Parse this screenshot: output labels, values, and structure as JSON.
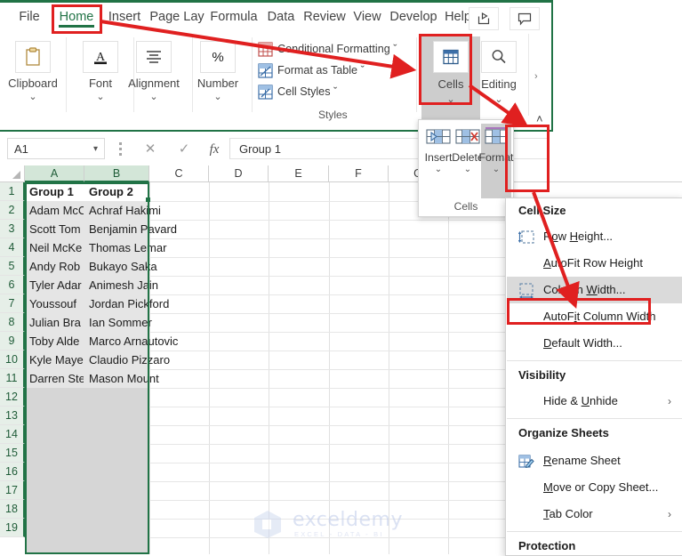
{
  "colors": {
    "excel_green": "#217346",
    "annotation_red": "#e02020",
    "selection_fill": "#d6d6d6",
    "menu_highlight": "#dadada",
    "header_selected": "#d3e6d8"
  },
  "ribbon": {
    "tabs": [
      {
        "label": "File",
        "active": false
      },
      {
        "label": "Home",
        "active": true
      },
      {
        "label": "Insert",
        "active": false
      },
      {
        "label": "Page Lay",
        "active": false
      },
      {
        "label": "Formula",
        "active": false
      },
      {
        "label": "Data",
        "active": false
      },
      {
        "label": "Review",
        "active": false
      },
      {
        "label": "View",
        "active": false
      },
      {
        "label": "Develop",
        "active": false
      },
      {
        "label": "Help",
        "active": false
      }
    ],
    "quick_access": [
      {
        "name": "share-icon"
      },
      {
        "name": "comment-icon"
      }
    ],
    "groups": [
      {
        "label": "Clipboard",
        "icon": "clipboard-icon",
        "caret": "⌄"
      },
      {
        "label": "Font",
        "icon": "font-a-icon",
        "caret": "⌄"
      },
      {
        "label": "Alignment",
        "icon": "alignment-icon",
        "caret": "⌄"
      },
      {
        "label": "Number",
        "icon": "percent-icon",
        "caret": "⌄"
      },
      {
        "label": "Cells",
        "icon": "cells-grid-icon",
        "caret": "⌄"
      },
      {
        "label": "Editing",
        "icon": "magnifier-icon",
        "caret": "⌄"
      }
    ],
    "styles": {
      "group_label": "Styles",
      "items": [
        {
          "label": "Conditional Formatting",
          "icon": "conditional-formatting-icon",
          "caret": "ˇ"
        },
        {
          "label": "Format as Table",
          "icon": "format-as-table-icon",
          "caret": "ˇ"
        },
        {
          "label": "Cell Styles",
          "icon": "cell-styles-icon",
          "caret": "ˇ"
        }
      ]
    },
    "scroll_arrow": "›",
    "collapse_caret": "˄"
  },
  "formula_bar": {
    "name_box_value": "A1",
    "name_box_caret": "▾",
    "cancel_icon": "✕",
    "enter_icon": "✓",
    "function_icon": "fx",
    "formula_value": "Group 1"
  },
  "grid": {
    "column_headers": [
      "A",
      "B",
      "C",
      "D",
      "E",
      "F",
      "G"
    ],
    "selected_columns": [
      "A",
      "B"
    ],
    "row_headers": [
      "1",
      "2",
      "3",
      "4",
      "5",
      "6",
      "7",
      "8",
      "9",
      "10",
      "11",
      "12",
      "13",
      "14",
      "15",
      "16",
      "17",
      "18",
      "19"
    ],
    "selected_rows_all": true,
    "rows": [
      {
        "num": "1",
        "a": "Group 1",
        "b": "Group 2",
        "header": true
      },
      {
        "num": "2",
        "a": "Adam McC",
        "b": "Achraf Hakimi"
      },
      {
        "num": "3",
        "a": "Scott Tom",
        "b": "Benjamin Pavard"
      },
      {
        "num": "4",
        "a": "Neil McKe",
        "b": "Thomas Lemar"
      },
      {
        "num": "5",
        "a": "Andy Rob",
        "b": "Bukayo Saka"
      },
      {
        "num": "6",
        "a": "Tyler Adar",
        "b": "Animesh Jain"
      },
      {
        "num": "7",
        "a": "Youssouf ",
        "b": "Jordan Pickford"
      },
      {
        "num": "8",
        "a": "Julian Bra",
        "b": "Ian Sommer"
      },
      {
        "num": "9",
        "a": "Toby Alde",
        "b": "Marco Arnautovic"
      },
      {
        "num": "10",
        "a": "Kyle Maye",
        "b": "Claudio Pizzaro"
      },
      {
        "num": "11",
        "a": "Darren Ste",
        "b": "Mason Mount"
      },
      {
        "num": "12",
        "a": "",
        "b": ""
      },
      {
        "num": "13",
        "a": "",
        "b": ""
      },
      {
        "num": "14",
        "a": "",
        "b": ""
      },
      {
        "num": "15",
        "a": "",
        "b": ""
      },
      {
        "num": "16",
        "a": "",
        "b": ""
      },
      {
        "num": "17",
        "a": "",
        "b": ""
      },
      {
        "num": "18",
        "a": "",
        "b": ""
      },
      {
        "num": "19",
        "a": "",
        "b": ""
      }
    ]
  },
  "cells_panel": {
    "group_label": "Cells",
    "buttons": [
      {
        "label": "Insert",
        "icon": "insert-cells-icon",
        "caret": "⌄",
        "highlighted": false
      },
      {
        "label": "Delete",
        "icon": "delete-cells-icon",
        "caret": "⌄",
        "highlighted": false
      },
      {
        "label": "Format",
        "icon": "format-cells-icon",
        "caret": "⌄",
        "highlighted": true
      }
    ]
  },
  "format_menu": {
    "sections": [
      {
        "header": "Cell Size",
        "items": [
          {
            "label": "Row Height...",
            "icon": "row-height-icon",
            "accel": "H",
            "highlighted": false,
            "submenu": false
          },
          {
            "label": "AutoFit Row Height",
            "icon": "",
            "accel": "A",
            "highlighted": false,
            "submenu": false
          },
          {
            "label": "Column Width...",
            "icon": "column-width-icon",
            "accel": "W",
            "highlighted": true,
            "submenu": false
          },
          {
            "label": "AutoFit Column Width",
            "icon": "",
            "accel": "i",
            "highlighted": false,
            "submenu": false
          },
          {
            "label": "Default Width...",
            "icon": "",
            "accel": "D",
            "highlighted": false,
            "submenu": false
          }
        ]
      },
      {
        "header": "Visibility",
        "items": [
          {
            "label": "Hide & Unhide",
            "icon": "",
            "accel": "U",
            "highlighted": false,
            "submenu": true
          }
        ]
      },
      {
        "header": "Organize Sheets",
        "items": [
          {
            "label": "Rename Sheet",
            "icon": "rename-sheet-icon",
            "accel": "R",
            "highlighted": false,
            "submenu": false
          },
          {
            "label": "Move or Copy Sheet...",
            "icon": "",
            "accel": "M",
            "highlighted": false,
            "submenu": false
          },
          {
            "label": "Tab Color",
            "icon": "",
            "accel": "T",
            "highlighted": false,
            "submenu": true
          }
        ]
      },
      {
        "header": "Protection",
        "items": []
      }
    ],
    "submenu_arrow": "›"
  },
  "annotations": {
    "boxes": [
      {
        "name": "home-tab-highlight"
      },
      {
        "name": "cells-button-highlight"
      },
      {
        "name": "format-button-highlight"
      },
      {
        "name": "column-width-highlight"
      }
    ],
    "arrows": [
      {
        "name": "arrow-home-to-cells"
      },
      {
        "name": "arrow-cells-to-format"
      },
      {
        "name": "arrow-format-to-column-width"
      }
    ]
  },
  "watermark": {
    "title": "exceldemy",
    "subtitle": "EXCEL - DATA - BI",
    "logo": "exceldemy-logo-icon"
  }
}
